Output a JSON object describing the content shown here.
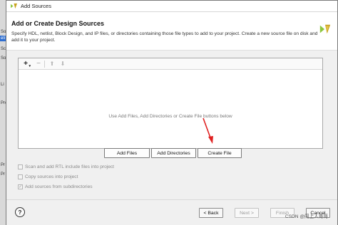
{
  "window": {
    "title": "Add Sources"
  },
  "background_app": {
    "fragments": [
      "So",
      "eli",
      "Sc",
      "Sou",
      "Li",
      "Pro",
      "Pr",
      "Pr"
    ]
  },
  "header": {
    "title": "Add or Create Design Sources",
    "description": "Specify HDL, netlist, Block Design, and IP files, or directories containing those file types to add to your project. Create a new source file on disk and add it to your project."
  },
  "file_panel": {
    "empty_message": "Use Add Files, Add Directories or Create File buttons below",
    "toolbar": {
      "add": "+",
      "remove": "−",
      "up": "⬆",
      "down": "⬇"
    }
  },
  "buttons": {
    "add_files": "Add Files",
    "add_directories": "Add Directories",
    "create_file": "Create File"
  },
  "options": [
    {
      "label": "Scan and add RTL include files into project",
      "checked": false
    },
    {
      "label": "Copy sources into project",
      "checked": false
    },
    {
      "label": "Add sources from subdirectories",
      "checked": true
    }
  ],
  "footer": {
    "help": "?",
    "back": "< Back",
    "next": "Next >",
    "finish": "Finish",
    "cancel": "Cancel"
  },
  "watermark": "CSDN @闯上人哥哥",
  "colors": {
    "accent": "#2f6fd1",
    "arrow": "#e02020",
    "logo": "#8dc63f"
  }
}
